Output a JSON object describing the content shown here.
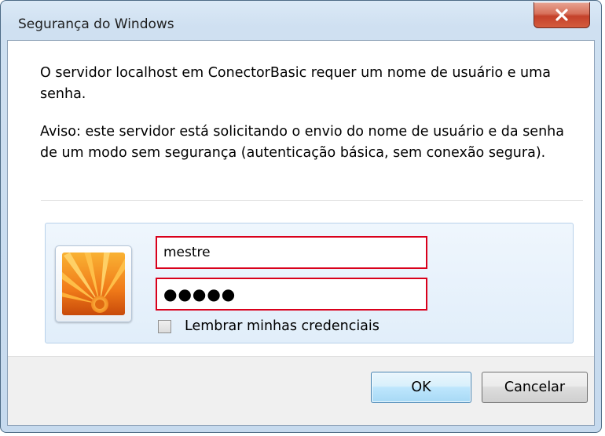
{
  "window": {
    "title": "Segurança do Windows",
    "close_icon": "close-icon"
  },
  "message": {
    "line1": "O servidor localhost em ConectorBasic requer um nome de usuário e uma senha.",
    "warning": "Aviso: este servidor está solicitando o envio do nome de usuário e da senha de um modo sem segurança (autenticação básica, sem conexão segura)."
  },
  "credentials": {
    "avatar_icon": "user-picture-icon",
    "username_value": "mestre",
    "password_value": "●●●●●",
    "remember_label": "Lembrar minhas credenciais",
    "remember_checked": false,
    "highlight_color": "#d9001b"
  },
  "buttons": {
    "ok_label": "OK",
    "cancel_label": "Cancelar"
  }
}
